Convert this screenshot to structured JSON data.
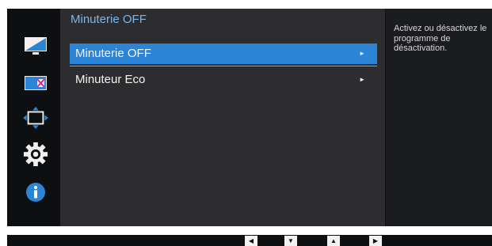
{
  "menu": {
    "title": "Minuterie OFF",
    "items": [
      {
        "label": "Minuterie OFF",
        "arrow": "►",
        "selected": true
      },
      {
        "label": "Minuteur Eco",
        "arrow": "►",
        "selected": false
      }
    ]
  },
  "help": {
    "text": "Activez ou désactivez le programme de désactivation."
  },
  "sidebar": {
    "icons": [
      "picture-icon",
      "color-icon",
      "size-position-icon",
      "settings-gear-icon",
      "info-icon"
    ]
  },
  "navbar": {
    "buttons": [
      {
        "name": "left-arrow",
        "glyph": "◀"
      },
      {
        "name": "down-arrow",
        "glyph": "▼"
      },
      {
        "name": "up-arrow",
        "glyph": "▲"
      },
      {
        "name": "right-arrow",
        "glyph": "▶"
      }
    ]
  },
  "colors": {
    "accent": "#2c84d7",
    "title": "#78b7ef",
    "panel": "#2d2d30",
    "background": "#0e0f11"
  }
}
